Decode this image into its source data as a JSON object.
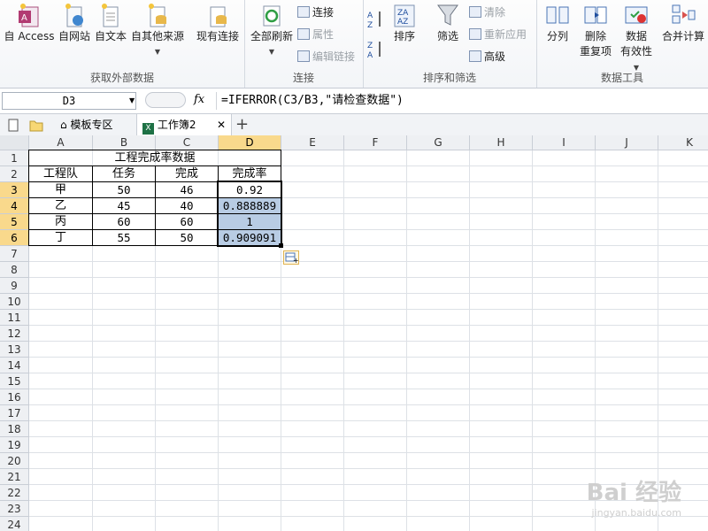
{
  "ribbon": {
    "get_external": {
      "label": "获取外部数据",
      "buttons": [
        "自 Access",
        "自网站",
        "自文本",
        "自其他来源",
        "现有连接"
      ]
    },
    "connections": {
      "label": "连接",
      "refresh_all": "全部刷新",
      "items": [
        "连接",
        "属性",
        "编辑链接"
      ]
    },
    "sort_filter": {
      "label": "排序和筛选",
      "sort": "排序",
      "filter": "筛选",
      "items": [
        "清除",
        "重新应用",
        "高级"
      ]
    },
    "data_tools": {
      "label": "数据工具",
      "split": "分列",
      "remove_dup_1": "删除",
      "remove_dup_2": "重复项",
      "validation_1": "数据",
      "validation_2": "有效性",
      "consolidate": "合并计算"
    }
  },
  "formula_bar": {
    "name_box": "D3",
    "fx": "fx",
    "formula": "=IFERROR(C3/B3,\"请检查数据\")"
  },
  "tabs": [
    {
      "label": "模板专区"
    },
    {
      "label": "工作簿2"
    }
  ],
  "columns": [
    "A",
    "B",
    "C",
    "D",
    "E",
    "F",
    "G",
    "H",
    "I",
    "J",
    "K"
  ],
  "rows": [
    "1",
    "2",
    "3",
    "4",
    "5",
    "6",
    "7",
    "8",
    "9",
    "10",
    "11",
    "12",
    "13",
    "14",
    "15",
    "16",
    "17",
    "18",
    "19",
    "20",
    "21",
    "22",
    "23",
    "24"
  ],
  "sheet": {
    "title": "工程完成率数据",
    "headers": [
      "工程队",
      "任务",
      "完成",
      "完成率"
    ],
    "data": [
      [
        "甲",
        "50",
        "46",
        "0.92"
      ],
      [
        "乙",
        "45",
        "40",
        "0.888889"
      ],
      [
        "丙",
        "60",
        "60",
        "1"
      ],
      [
        "丁",
        "55",
        "50",
        "0.909091"
      ]
    ]
  },
  "watermark": {
    "main": "Bai 经验",
    "sub": "jingyan.baidu.com"
  },
  "colors": {
    "selection": "#b8cce4",
    "header_selected": "#f9d98c"
  }
}
